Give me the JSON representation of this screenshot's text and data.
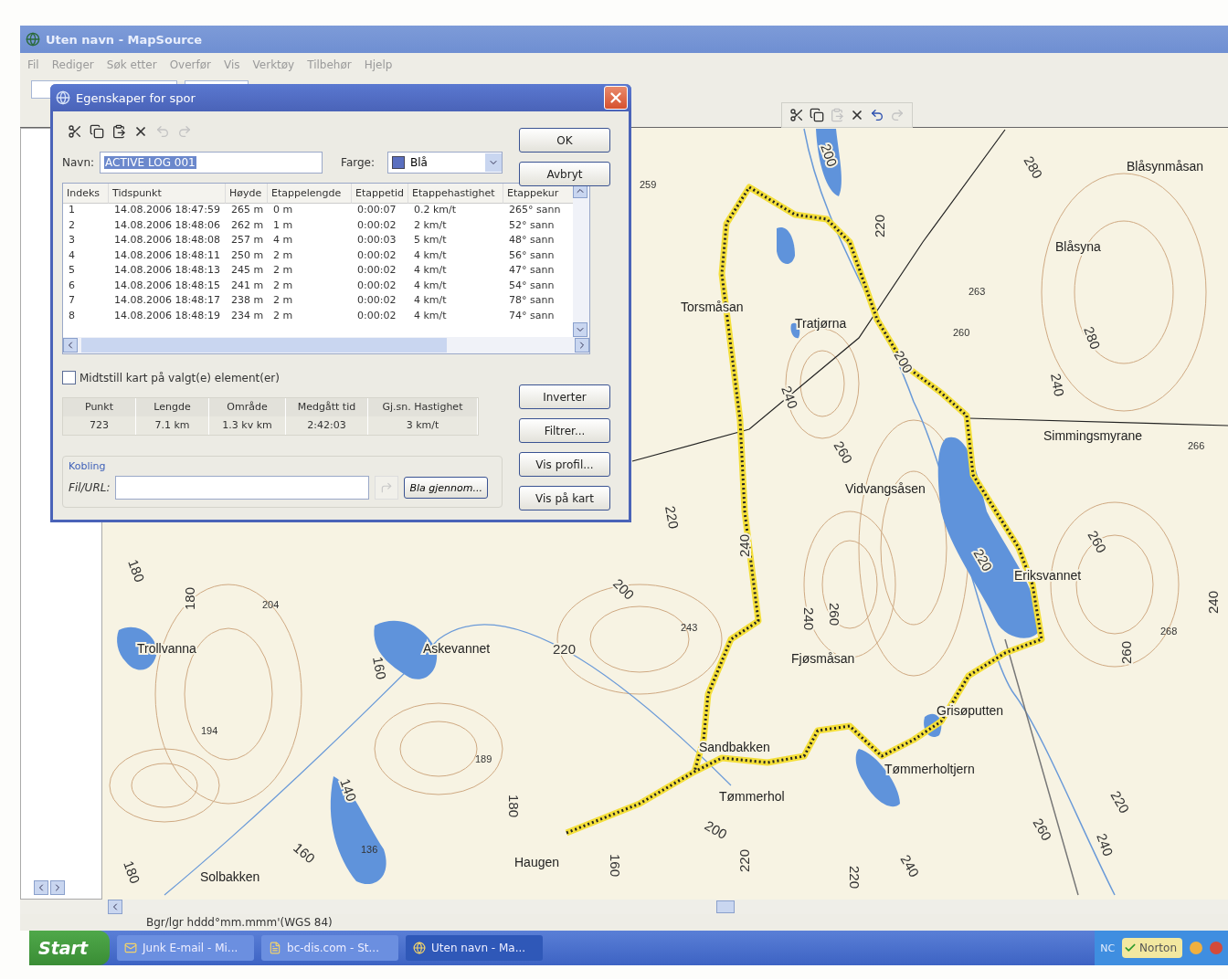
{
  "window": {
    "title": "Uten navn - MapSource"
  },
  "menu": [
    "Fil",
    "Rediger",
    "Søk etter",
    "Overfør",
    "Vis",
    "Verktøy",
    "Tilbehør",
    "Hjelp"
  ],
  "map_toolbar": [
    {
      "kind": "cut",
      "disabled": false
    },
    {
      "kind": "copy",
      "disabled": false
    },
    {
      "kind": "paste",
      "disabled": true
    },
    {
      "kind": "delete",
      "disabled": false
    },
    {
      "kind": "undo",
      "disabled": false
    },
    {
      "kind": "redo",
      "disabled": true
    }
  ],
  "map": {
    "places": [
      "Blåsynmåsan",
      "Blåsyna",
      "Torsmåsan",
      "Tratjørna",
      "Simmingsmyrane",
      "Vidvangsåsen",
      "Eriksvannet",
      "Trollvanna",
      "Askevannet",
      "Fjøsmåsan",
      "Grisøputten",
      "Sandbakken",
      "Tømmerholtjern",
      "Tømmerhol",
      "Haugen",
      "Solbakken"
    ],
    "spot_heights": [
      "259",
      "263",
      "260",
      "266",
      "204",
      "243",
      "268",
      "194",
      "189",
      "136"
    ],
    "contour_labels": [
      "200",
      "220",
      "280",
      "280",
      "240",
      "240",
      "260",
      "260",
      "220",
      "240",
      "260",
      "240",
      "200",
      "220",
      "220",
      "180",
      "180",
      "160",
      "140",
      "180",
      "200",
      "160",
      "160",
      "180",
      "220",
      "220",
      "240",
      "260",
      "220",
      "240",
      "260",
      "240",
      "200"
    ]
  },
  "status_bar": "Bgr/lgr hddd°mm.mmm'(WGS 84)",
  "dialog": {
    "title": "Egenskaper for spor",
    "toolbar": [
      {
        "kind": "cut",
        "disabled": false
      },
      {
        "kind": "copy",
        "disabled": false
      },
      {
        "kind": "paste",
        "disabled": false
      },
      {
        "kind": "delete",
        "disabled": false
      },
      {
        "kind": "undo",
        "disabled": true
      },
      {
        "kind": "redo",
        "disabled": true
      }
    ],
    "name_label": "Navn:",
    "name_value": "ACTIVE LOG 001",
    "color_label": "Farge:",
    "color_value": "Blå",
    "buttons": [
      "OK",
      "Avbryt"
    ],
    "table": {
      "columns": [
        "Indeks",
        "Tidspunkt",
        "Høyde",
        "Etappelengde",
        "Etappetid",
        "Etappehastighet",
        "Etappekur"
      ],
      "rows": [
        [
          "1",
          "14.08.2006 18:47:59",
          "265 m",
          "0 m",
          "0:00:07",
          "0.2 km/t",
          "265° sann"
        ],
        [
          "2",
          "14.08.2006 18:48:06",
          "262 m",
          "1 m",
          "0:00:02",
          "2 km/t",
          "52° sann"
        ],
        [
          "3",
          "14.08.2006 18:48:08",
          "257 m",
          "4 m",
          "0:00:03",
          "5 km/t",
          "48° sann"
        ],
        [
          "4",
          "14.08.2006 18:48:11",
          "250 m",
          "2 m",
          "0:00:02",
          "4 km/t",
          "56° sann"
        ],
        [
          "5",
          "14.08.2006 18:48:13",
          "245 m",
          "2 m",
          "0:00:02",
          "4 km/t",
          "47° sann"
        ],
        [
          "6",
          "14.08.2006 18:48:15",
          "241 m",
          "2 m",
          "0:00:02",
          "4 km/t",
          "54° sann"
        ],
        [
          "7",
          "14.08.2006 18:48:17",
          "238 m",
          "2 m",
          "0:00:02",
          "4 km/t",
          "78° sann"
        ],
        [
          "8",
          "14.08.2006 18:48:19",
          "234 m",
          "2 m",
          "0:00:02",
          "4 km/t",
          "74° sann"
        ]
      ]
    },
    "center_checkbox": {
      "label": "Midtstill kart på valgt(e) element(er)",
      "checked": false
    },
    "summary": {
      "columns": [
        "Punkt",
        "Lengde",
        "Område",
        "Medgått tid",
        "Gj.sn. Hastighet"
      ],
      "values": [
        "723",
        "7.1 km",
        "1.3 kv km",
        "2:42:03",
        "3 km/t"
      ]
    },
    "side_buttons": [
      "Inverter",
      "Filtrer...",
      "Vis profil...",
      "Vis på kart"
    ],
    "link_group": {
      "title": "Kobling",
      "label": "Fil/URL:",
      "browse": "Bla gjennom..."
    }
  },
  "taskbar": {
    "start": "Start",
    "tasks": [
      {
        "kind": "mail",
        "label": "Junk E-mail - Mi..."
      },
      {
        "kind": "page",
        "label": "bc-dis.com - St..."
      },
      {
        "kind": "globe",
        "label": "Uten navn - Ma..."
      }
    ],
    "tray_text": "NC",
    "norton": "Norton"
  }
}
